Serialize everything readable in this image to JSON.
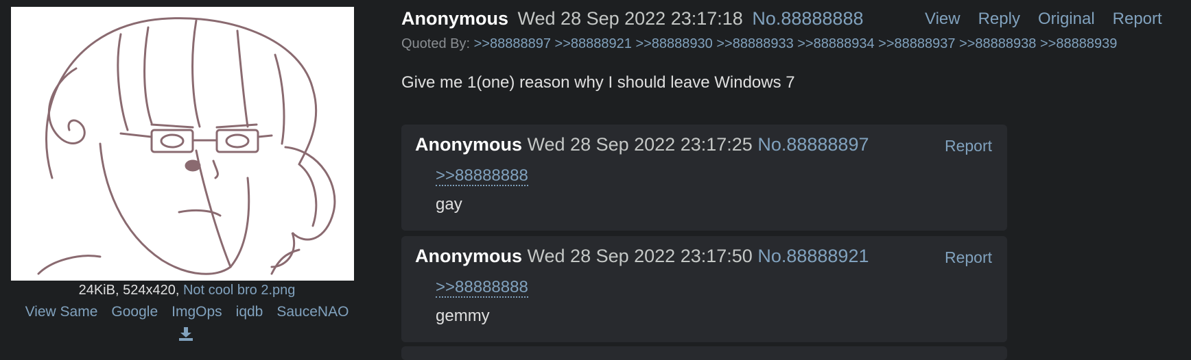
{
  "thumbnail": {
    "file_size": "24KiB",
    "dimensions": "524x420",
    "filename": "Not cool bro 2.png",
    "search_links": [
      "View Same",
      "Google",
      "ImgOps",
      "iqdb",
      "SauceNAO"
    ]
  },
  "op": {
    "name": "Anonymous",
    "date": "Wed 28 Sep 2022 23:17:18",
    "number": "No.88888888",
    "actions": [
      "View",
      "Reply",
      "Original",
      "Report"
    ],
    "quoted_by_label": "Quoted By:",
    "quoted_by": [
      ">>88888897",
      ">>88888921",
      ">>88888930",
      ">>88888933",
      ">>88888934",
      ">>88888937",
      ">>88888938",
      ">>88888939"
    ],
    "text": "Give me 1(one) reason why I should leave Windows 7"
  },
  "replies": [
    {
      "name": "Anonymous",
      "date": "Wed 28 Sep 2022 23:17:25",
      "number": "No.88888897",
      "report": "Report",
      "quote": ">>88888888",
      "text": "gay"
    },
    {
      "name": "Anonymous",
      "date": "Wed 28 Sep 2022 23:17:50",
      "number": "No.88888921",
      "report": "Report",
      "quote": ">>88888888",
      "text": "gemmy"
    }
  ],
  "colors": {
    "background": "#1d1f21",
    "reply_background": "#282a2e",
    "link": "#81a2be",
    "text": "#c5c8c6"
  },
  "icons": [
    "download-icon"
  ]
}
